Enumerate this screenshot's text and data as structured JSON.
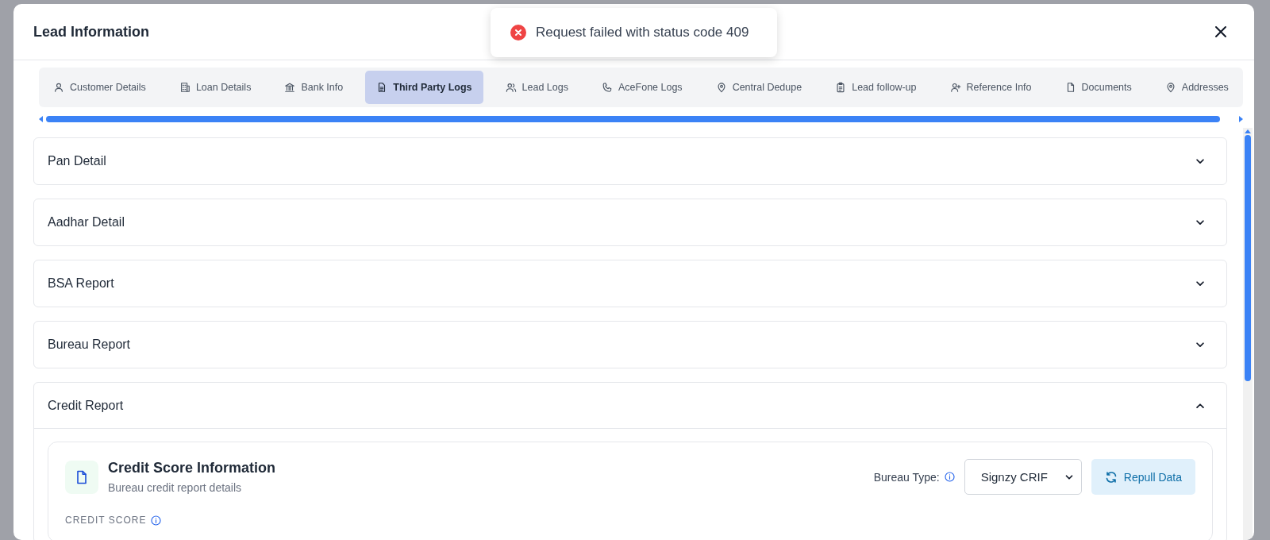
{
  "window": {
    "title": "Lead Information"
  },
  "toast": {
    "message": "Request failed with status code 409"
  },
  "tabs": [
    {
      "label": "Customer Details",
      "selected": false
    },
    {
      "label": "Loan Details",
      "selected": false
    },
    {
      "label": "Bank Info",
      "selected": false
    },
    {
      "label": "Third Party Logs",
      "selected": true
    },
    {
      "label": "Lead Logs",
      "selected": false
    },
    {
      "label": "AceFone Logs",
      "selected": false
    },
    {
      "label": "Central Dedupe",
      "selected": false
    },
    {
      "label": "Lead follow-up",
      "selected": false
    },
    {
      "label": "Reference Info",
      "selected": false
    },
    {
      "label": "Documents",
      "selected": false
    },
    {
      "label": "Addresses",
      "selected": false
    }
  ],
  "sections": [
    {
      "title": "Pan Detail",
      "expanded": false
    },
    {
      "title": "Aadhar Detail",
      "expanded": false
    },
    {
      "title": "BSA Report",
      "expanded": false
    },
    {
      "title": "Bureau Report",
      "expanded": false
    },
    {
      "title": "Credit Report",
      "expanded": true
    }
  ],
  "credit_card": {
    "title": "Credit Score Information",
    "subtitle": "Bureau credit report details",
    "bureau_type_label": "Bureau Type:",
    "bureau_type_value": "Signzy CRIF",
    "repull_button": "Repull Data",
    "credit_score_label": "CREDIT SCORE"
  }
}
